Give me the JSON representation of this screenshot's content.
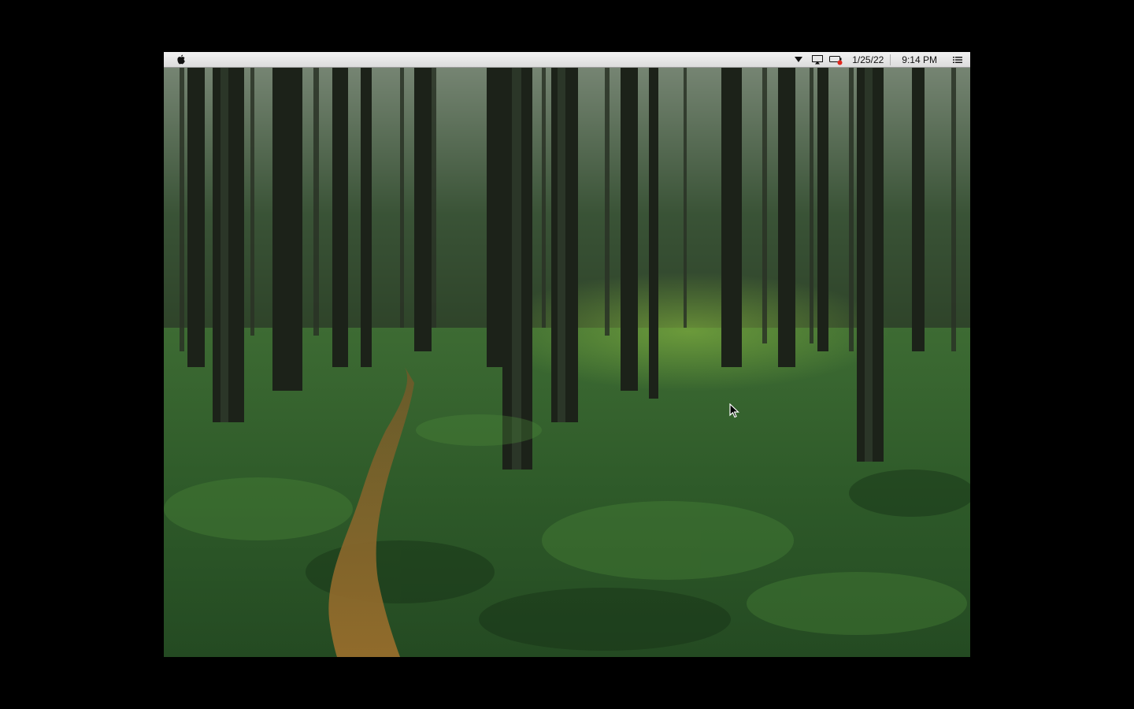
{
  "menubar": {
    "apple_icon": "apple-logo-icon",
    "status_icons": [
      "dropdown-triangle-icon",
      "airplay-display-icon",
      "battery-alert-icon"
    ],
    "date": "1/25/22",
    "time": "9:14 PM",
    "menu_icon": "list-menu-icon"
  },
  "desktop": {
    "wallpaper": "forest-path-wallpaper",
    "colors": {
      "canopy": "#2b4a2b",
      "moss": "#3f7a34",
      "path": "#8a6a2a",
      "trunk": "#1c2219"
    }
  },
  "cursor": "arrow-pointer-icon"
}
